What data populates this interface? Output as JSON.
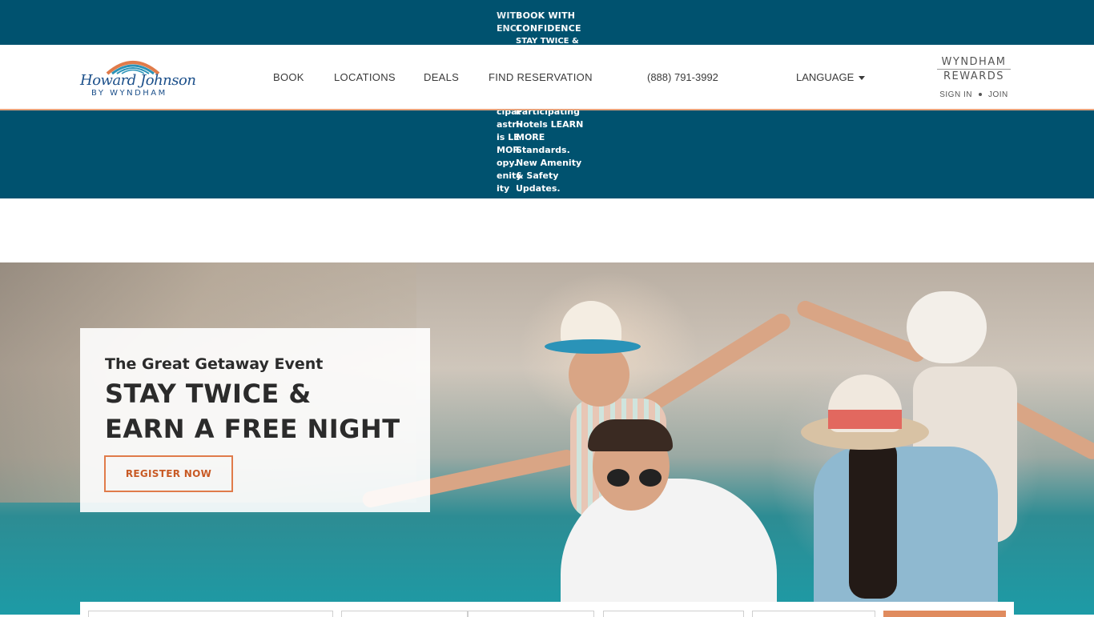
{
  "promo": {
    "col_a_heading": "WITH",
    "col_a_body": "ENCE",
    "col_b_heading": "BOOK WITH",
    "col_b_heading2": "CONFIDENCE",
    "col_b_overlap": "STAY TWICE &",
    "bottom_a": "cipating\nastrictions\nis LEARN\nMORE\nopy.\nenity\nity\nes.",
    "bottom_b_1": "Participating",
    "bottom_b_2": "Hotels LEARN",
    "bottom_b_3": "MORE",
    "bottom_b_4": "Standards.",
    "bottom_b_5": "New Amenity",
    "bottom_b_6": "& Safety",
    "bottom_b_7": "Updates."
  },
  "header": {
    "logo_brand": "Howard Johnson",
    "logo_sub": "BY WYNDHAM",
    "nav": [
      "BOOK",
      "LOCATIONS",
      "DEALS",
      "FIND RESERVATION"
    ],
    "phone": "(888) 791-3992",
    "language": "LANGUAGE",
    "rewards_line1": "WYNDHAM",
    "rewards_line2": "REWARDS",
    "sign_in": "SIGN IN",
    "join": "JOIN"
  },
  "hero": {
    "eyebrow": "The Great Getaway Event",
    "headline_line1": "STAY TWICE &",
    "headline_line2": "EARN A FREE NIGHT",
    "cta": "REGISTER NOW"
  },
  "colors": {
    "banner": "#00526f",
    "accent": "#e07b4a",
    "brand_blue": "#1b4f8a"
  }
}
